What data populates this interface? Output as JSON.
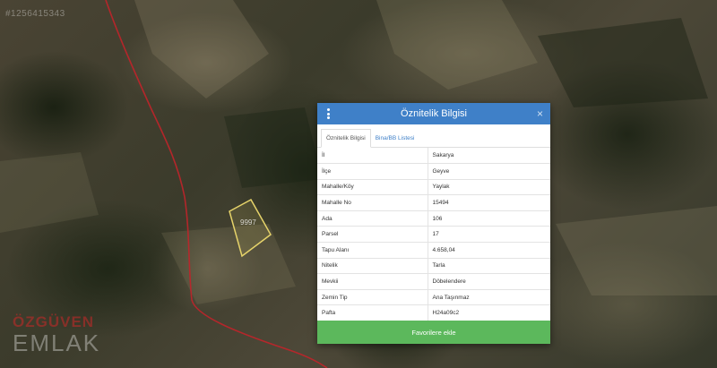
{
  "map": {
    "watermark_id": "#1256415343",
    "parcel_label": "9997",
    "brand_top": "ÖZGÜVEN",
    "brand_bottom": "EMLAK"
  },
  "panel": {
    "title": "Öznitelik Bilgisi",
    "close_label": "×",
    "tabs": [
      {
        "label": "Öznitelik Bilgisi",
        "active": true
      },
      {
        "label": "Bina/BB Listesi",
        "active": false
      }
    ],
    "rows": [
      {
        "key": "İl",
        "value": "Sakarya"
      },
      {
        "key": "İlçe",
        "value": "Geyve"
      },
      {
        "key": "Mahalle/Köy",
        "value": "Yaylak"
      },
      {
        "key": "Mahalle No",
        "value": "15494"
      },
      {
        "key": "Ada",
        "value": "106"
      },
      {
        "key": "Parsel",
        "value": "17"
      },
      {
        "key": "Tapu Alanı",
        "value": "4.658,04"
      },
      {
        "key": "Nitelik",
        "value": "Tarla"
      },
      {
        "key": "Mevkii",
        "value": "Döbelendere"
      },
      {
        "key": "Zemin Tip",
        "value": "Ana Taşınmaz"
      },
      {
        "key": "Pafta",
        "value": "H24a09c2"
      }
    ],
    "favorite_button": "Favorilere ekle"
  },
  "colors": {
    "header": "#3f80c8",
    "button": "#5cb85c",
    "road": "#c0232a",
    "parcel_outline": "#e6d36a"
  }
}
